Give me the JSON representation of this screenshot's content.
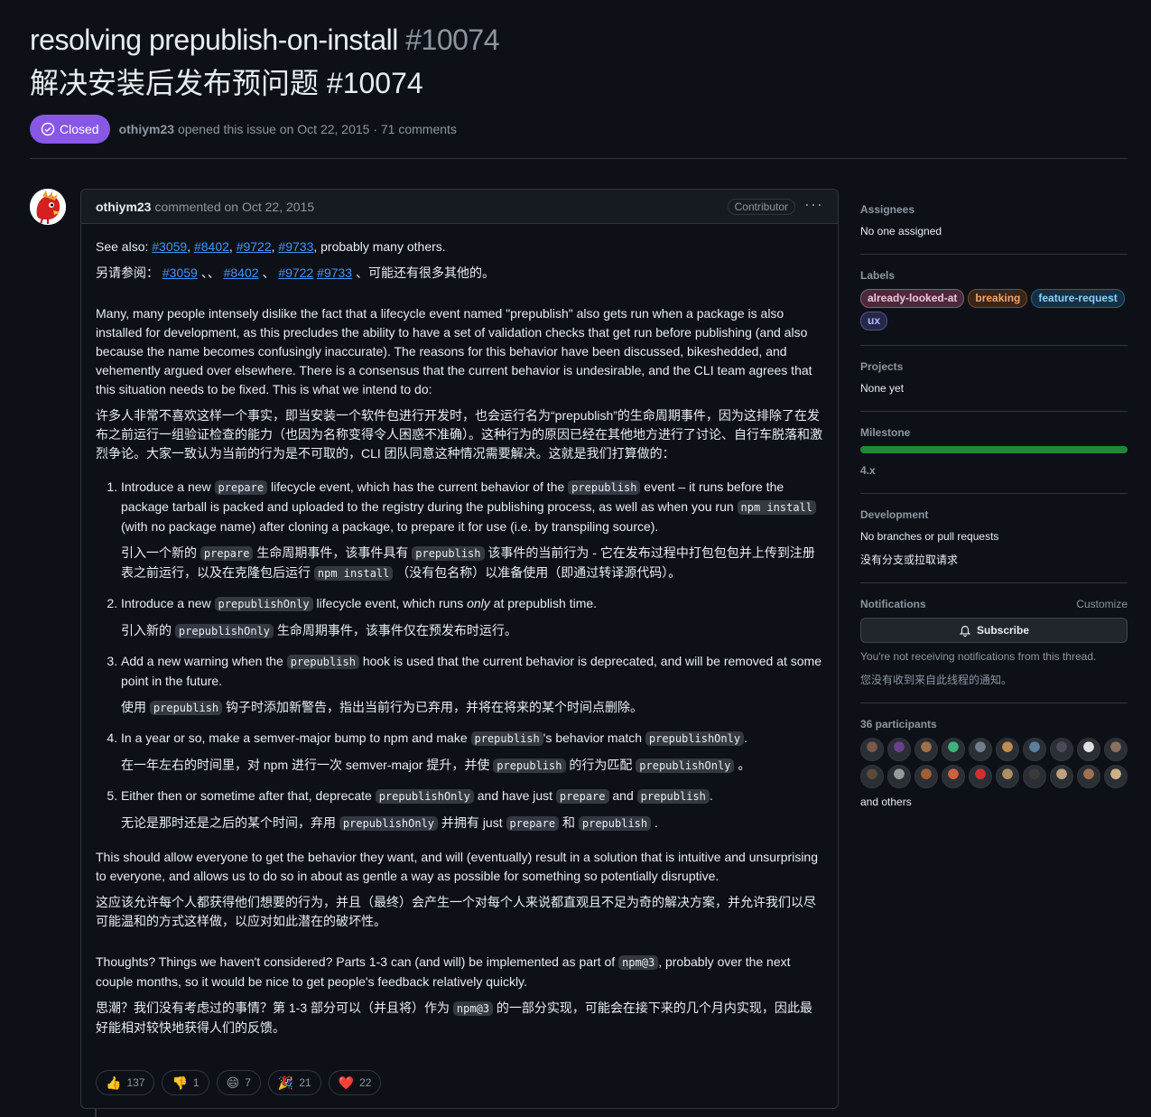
{
  "issue": {
    "title": "resolving prepublish-on-install",
    "number": "#10074",
    "title_zh": "解决安装后发布预问题 #10074",
    "state": "Closed",
    "author": "othiym23",
    "opened_text": "opened this issue on Oct 22, 2015 · 71 comments"
  },
  "comment": {
    "author": "othiym23",
    "date_text": "commented on Oct 22, 2015",
    "badge": "Contributor",
    "menu_icon": "kebab-horizontal-icon",
    "see_also": {
      "prefix": "See also: ",
      "links": [
        "#3059",
        "#8402",
        "#9722",
        "#9733"
      ],
      "suffix": ", probably many others."
    },
    "see_also_zh": {
      "prefix": "另请参阅：",
      "links": [
        "#3059",
        "#8402",
        "#9722",
        "#9733"
      ],
      "sep1": "、、",
      "sep2": "、",
      "suffix": "、可能还有很多其他的。"
    },
    "para1": "Many, many people intensely dislike the fact that a lifecycle event named \"prepublish\" also gets run when a package is also installed for development, as this precludes the ability to have a set of validation checks that get run before publishing (and also because the name becomes confusingly inaccurate). The reasons for this behavior have been discussed, bikeshedded, and vehemently argued over elsewhere. There is a consensus that the current behavior is undesirable, and the CLI team agrees that this situation needs to be fixed. This is what we intend to do:",
    "para1_zh": "许多人非常不喜欢这样一个事实，即当安装一个软件包进行开发时，也会运行名为“prepublish”的生命周期事件，因为这排除了在发布之前运行一组验证检查的能力（也因为名称变得令人困惑不准确）。这种行为的原因已经在其他地方进行了讨论、自行车脱落和激烈争论。大家一致认为当前的行为是不可取的，CLI 团队同意这种情况需要解决。这就是我们打算做的：",
    "list": [
      {
        "parts": [
          "Introduce a new ",
          "prepare",
          " lifecycle event, which has the current behavior of the ",
          "prepublish",
          " event – it runs before the package tarball is packed and uploaded to the registry during the publishing process, as well as when you run ",
          "npm install",
          " (with no package name) after cloning a package, to prepare it for use (i.e. by transpiling source)."
        ],
        "zh": [
          "引入一个新的 ",
          "prepare",
          " 生命周期事件，该事件具有 ",
          "prepublish",
          " 该事件的当前行为 - 它在发布过程中打包包包并上传到注册表之前运行，以及在克隆包后运行 ",
          "npm install",
          " （没有包名称）以准备使用（即通过转译源代码）。"
        ]
      },
      {
        "parts": [
          "Introduce a new ",
          "prepublishOnly",
          " lifecycle event, which runs ",
          "only",
          " at prepublish time."
        ],
        "zh": [
          "引入新的 ",
          "prepublishOnly",
          " 生命周期事件，该事件仅在预发布时运行。"
        ]
      },
      {
        "parts": [
          "Add a new warning when the ",
          "prepublish",
          " hook is used that the current behavior is deprecated, and will be removed at some point in the future."
        ],
        "zh": [
          "使用 ",
          "prepublish",
          " 钩子时添加新警告，指出当前行为已弃用，并将在将来的某个时间点删除。"
        ]
      },
      {
        "parts": [
          "In a year or so, make a semver-major bump to npm and make ",
          "prepublish",
          "'s behavior match ",
          "prepublishOnly",
          "."
        ],
        "zh": [
          "在一年左右的时间里，对 npm 进行一次 semver-major 提升，并使 ",
          "prepublish",
          " 的行为匹配 ",
          "prepublishOnly",
          " 。"
        ]
      },
      {
        "parts": [
          "Either then or sometime after that, deprecate ",
          "prepublishOnly",
          " and have just ",
          "prepare",
          " and ",
          "prepublish",
          "."
        ],
        "zh": [
          "无论是那时还是之后的某个时间，弃用 ",
          "prepublishOnly",
          " 并拥有 just ",
          "prepare",
          " 和 ",
          "prepublish",
          " ."
        ]
      }
    ],
    "para2": "This should allow everyone to get the behavior they want, and will (eventually) result in a solution that is intuitive and unsurprising to everyone, and allows us to do so in about as gentle a way as possible for something so potentially disruptive.",
    "para2_zh": "这应该允许每个人都获得他们想要的行为，并且（最终）会产生一个对每个人来说都直观且不足为奇的解决方案，并允许我们以尽可能温和的方式这样做，以应对如此潜在的破坏性。",
    "para3": [
      "Thoughts? Things we haven't considered? Parts 1-3 can (and will) be implemented as part of ",
      "npm@3",
      ", probably over the next couple months, so it would be nice to get people's feedback relatively quickly."
    ],
    "para3_zh": [
      "思潮？我们没有考虑过的事情？第 1-3 部分可以（并且将）作为 ",
      "npm@3",
      " 的一部分实现，可能会在接下来的几个月内实现，因此最好能相对较快地获得人们的反馈。"
    ],
    "reactions": [
      {
        "emoji": "👍",
        "name": "thumbs-up-icon",
        "count": "137"
      },
      {
        "emoji": "👎",
        "name": "thumbs-down-icon",
        "count": "1"
      },
      {
        "emoji": "😄",
        "name": "laugh-icon",
        "count": "7"
      },
      {
        "emoji": "🎉",
        "name": "hooray-icon",
        "count": "21"
      },
      {
        "emoji": "❤️",
        "name": "heart-icon",
        "count": "22"
      }
    ]
  },
  "sidebar": {
    "assignees": {
      "heading": "Assignees",
      "value": "No one assigned"
    },
    "labels": {
      "heading": "Labels",
      "items": [
        {
          "name": "already-looked-at",
          "color": "#f3c4dd",
          "bg": "#4a2a3a",
          "border": "#8c5a73"
        },
        {
          "name": "breaking",
          "color": "#f0a56e",
          "bg": "#3a2517",
          "border": "#7a4a28"
        },
        {
          "name": "feature-request",
          "color": "#8ed0f5",
          "bg": "#143045",
          "border": "#2a5f82"
        },
        {
          "name": "ux",
          "color": "#b3b9ff",
          "bg": "#25284a",
          "border": "#4d5290"
        }
      ]
    },
    "projects": {
      "heading": "Projects",
      "value": "None yet"
    },
    "milestone": {
      "heading": "Milestone",
      "name": "4.x",
      "progress": 1.0,
      "color": "#238636"
    },
    "development": {
      "heading": "Development",
      "value": "No branches or pull requests",
      "value_zh": "没有分支或拉取请求"
    },
    "notifications": {
      "heading": "Notifications",
      "customize": "Customize",
      "button": "Subscribe",
      "note": "You're not receiving notifications from this thread.",
      "note_zh": "您没有收到来自此线程的通知。"
    },
    "participants": {
      "heading": "36 participants",
      "count": 20,
      "colors": [
        "#7a5a48",
        "#6b3f8c",
        "#a0704a",
        "#3fb27f",
        "#6f7f8f",
        "#c08a50",
        "#5a7f9a",
        "#4a4a58",
        "#e0e0e0",
        "#8a7060",
        "#5a4a38",
        "#9a9a9a",
        "#a06030",
        "#d06040",
        "#d03030",
        "#b09060",
        "#3a3a3a",
        "#c0a080",
        "#a07050",
        "#d0b080"
      ],
      "others": "and others"
    }
  }
}
